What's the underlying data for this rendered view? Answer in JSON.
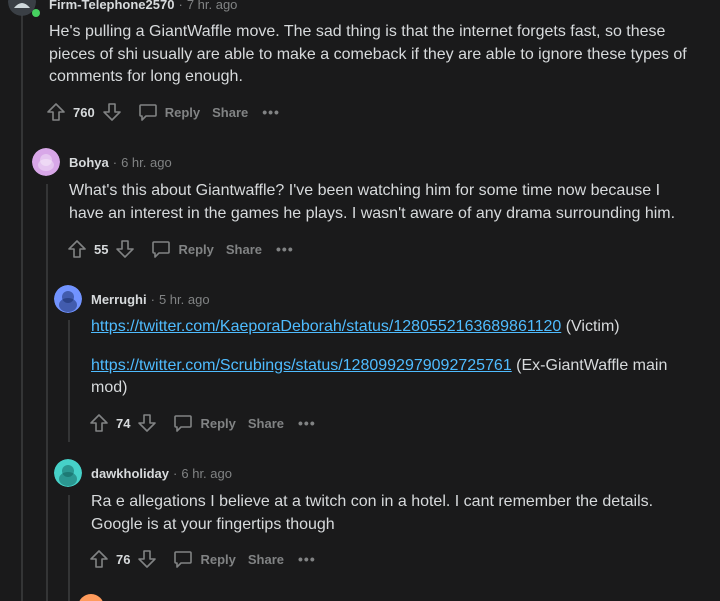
{
  "comments": [
    {
      "user": "Firm-Telephone2570",
      "time": "7 hr. ago",
      "body": "He's pulling a GiantWaffle move. The sad thing is that the internet forgets fast, so these pieces of shi  usually are able to make a comeback if they are able to ignore these types of comments for long enough.",
      "score": "760",
      "reply_label": "Reply",
      "share_label": "Share",
      "more_label": "•••",
      "online_color": "#46d160"
    },
    {
      "user": "Bohya",
      "time": "6 hr. ago",
      "body": "What's this about Giantwaffle? I've been watching him for some time now because I have an interest in the games he plays. I wasn't aware of any drama surrounding him.",
      "score": "55",
      "reply_label": "Reply",
      "share_label": "Share",
      "more_label": "•••",
      "avatar_color": "#d8a7e8"
    },
    {
      "user": "Merrughi",
      "time": "5 hr. ago",
      "link1": "https://twitter.com/KaeporaDeborah/status/1280552163689861120",
      "link1_suffix": " (Victim)",
      "link2": "https://twitter.com/Scrubings/status/1280992979092725761",
      "link2_suffix": " (Ex-GiantWaffle main mod)",
      "score": "74",
      "reply_label": "Reply",
      "share_label": "Share",
      "more_label": "•••",
      "avatar_color": "#7193ff"
    },
    {
      "user": "dawkholiday",
      "time": "6 hr. ago",
      "body": "Ra  e allegations I believe at a twitch con in a hotel. I cant remember the details. Google is at your fingertips though",
      "score": "76",
      "reply_label": "Reply",
      "share_label": "Share",
      "more_label": "•••",
      "avatar_color": "#46d1c8"
    }
  ],
  "separator": "·",
  "icons": {
    "upvote": "upvote-arrow-icon",
    "downvote": "downvote-arrow-icon",
    "reply": "speech-bubble-icon",
    "avatar": "snoo-avatar-icon"
  }
}
